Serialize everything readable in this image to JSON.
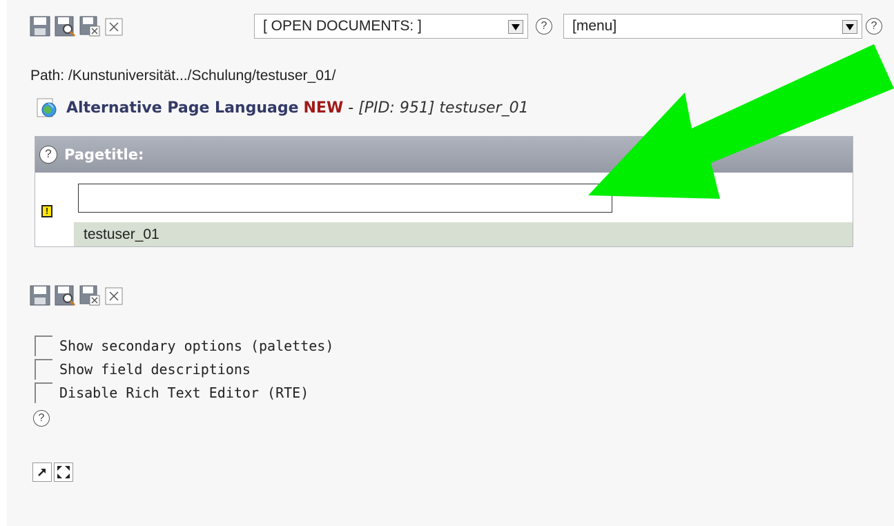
{
  "top_toolbar": {
    "icons": [
      "save-icon",
      "save-and-view-icon",
      "save-and-close-icon",
      "close-icon"
    ],
    "open_documents_select": "[ OPEN DOCUMENTS: ]",
    "menu_select": "[menu]",
    "help_glyph": "?"
  },
  "path": {
    "text": "Path: /Kunstuniversität.../Schulung/testuser_01/"
  },
  "record_title": {
    "main": "Alternative Page Language",
    "badge": "NEW",
    "separator": " - ",
    "pid": "[PID: 951] testuser_01"
  },
  "field": {
    "help_glyph": "?",
    "label": "Pagetitle:",
    "input_value": "",
    "warning_glyph": "!",
    "original_value": "testuser_01"
  },
  "bottom_toolbar": {
    "icons": [
      "save-icon",
      "save-and-view-icon",
      "save-and-close-icon",
      "close-icon"
    ]
  },
  "options": {
    "items": [
      {
        "label": "Show secondary options (palettes)",
        "checked": false
      },
      {
        "label": "Show field descriptions",
        "checked": false
      },
      {
        "label": "Disable Rich Text Editor (RTE)",
        "checked": false
      }
    ],
    "help_glyph": "?"
  },
  "window_controls": {
    "icons": [
      "open-in-new-window-icon",
      "fullscreen-icon"
    ]
  },
  "annotation": {
    "arrow_color": "#00ee00"
  }
}
